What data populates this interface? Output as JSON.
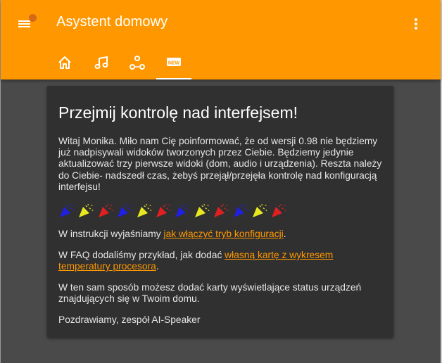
{
  "app": {
    "title": "Asystent domowy",
    "accent_color": "#ff9800",
    "notification_dot_color": "#d4691a"
  },
  "icons": {
    "menu": "hamburger-menu-icon",
    "overflow": "more-vertical-icon"
  },
  "tabs": [
    {
      "name": "home",
      "icon": "home-icon",
      "active": false
    },
    {
      "name": "music",
      "icon": "music-note-icon",
      "active": false
    },
    {
      "name": "devices",
      "icon": "hub-icon",
      "active": false
    },
    {
      "name": "new",
      "icon": "new-badge-icon",
      "active": true,
      "badge_text": "NEW"
    }
  ],
  "card": {
    "title": "Przejmij kontrolę nad interfejsem!",
    "intro": "Witaj Monika. Miło nam Cię poinformować, że od wersji 0.98 nie będziemy już nadpisywali widoków tworzonych przez Ciebie. Będziemy jedynie aktualizować trzy pierwsze widoki (dom, audio i urządzenia). Reszta należy do Ciebie- nadszedł czas, żebyś przejął/przejęła kontrolę nad konfiguracją interfejsu!",
    "confetti_colors": [
      "#2020e0",
      "#e8e820",
      "#e02020",
      "#2020e0",
      "#e8e820",
      "#e02020",
      "#2020e0",
      "#e8e820",
      "#e02020",
      "#2020e0",
      "#e8e820",
      "#e02020"
    ],
    "instructions_prefix": "W instrukcji wyjaśniamy ",
    "instructions_link": "jak włączyć tryb konfiguracji",
    "instructions_suffix": ".",
    "faq_prefix": "W FAQ dodaliśmy przykład, jak dodać ",
    "faq_link": "własną kartę z wykresem temperatury procesora",
    "faq_suffix": ".",
    "status_text": "W ten sam sposób możesz dodać karty wyświetlające status urządzeń znajdujących się w Twoim domu.",
    "signature": "Pozdrawiamy, zespół AI-Speaker"
  }
}
